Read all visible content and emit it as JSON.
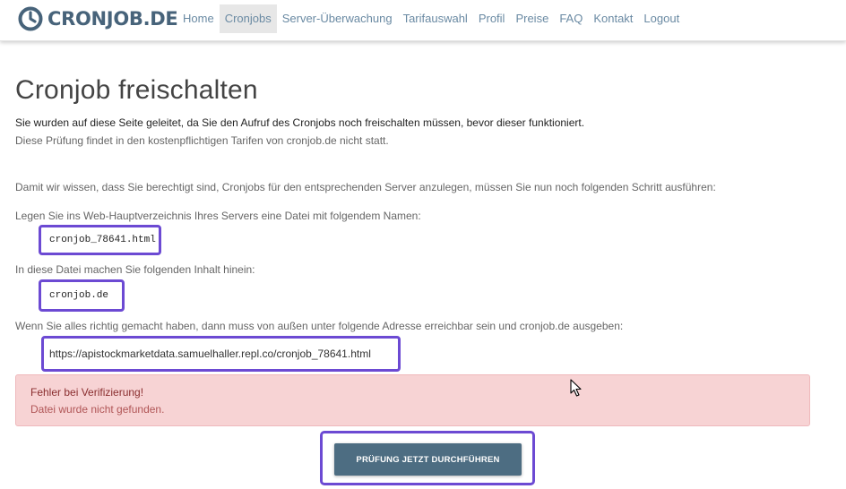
{
  "brand": {
    "name": "CRONJOB.DE",
    "color": "#47637a",
    "icon": "clock-logo-icon"
  },
  "nav": {
    "items": [
      {
        "label": "Home",
        "active": false
      },
      {
        "label": "Cronjobs",
        "active": true
      },
      {
        "label": "Server-Überwachung",
        "active": false
      },
      {
        "label": "Tarifauswahl",
        "active": false
      },
      {
        "label": "Profil",
        "active": false
      },
      {
        "label": "Preise",
        "active": false
      },
      {
        "label": "FAQ",
        "active": false
      },
      {
        "label": "Kontakt",
        "active": false
      },
      {
        "label": "Logout",
        "active": false
      }
    ]
  },
  "page": {
    "title": "Cronjob freischalten",
    "intro_strong": "Sie wurden auf diese Seite geleitet, da Sie den Aufruf des Cronjobs noch freischalten müssen, bevor dieser funktioniert.",
    "intro_note": "Diese Prüfung findet in den kostenpflichtigen Tarifen von cronjob.de nicht statt.",
    "step_intro": "Damit wir wissen, dass Sie berechtigt sind, Cronjobs für den entsprechenden Server anzulegen, müssen Sie nun noch folgenden Schritt ausführen:",
    "file_instruction": "Legen Sie ins Web-Hauptverzeichnis Ihres Servers eine Datei mit folgendem Namen:",
    "file_name": "cronjob_78641.html",
    "content_instruction": "In diese Datei machen Sie folgenden Inhalt hinein:",
    "file_content": "cronjob.de",
    "url_instruction": "Wenn Sie alles richtig gemacht haben, dann muss von außen unter folgende Adresse erreichbar sein und cronjob.de ausgeben:",
    "verify_url": "https://apistockmarketdata.samuelhaller.repl.co/cronjob_78641.html"
  },
  "alert": {
    "title": "Fehler bei Verifizierung!",
    "message": "Datei wurde nicht gefunden.",
    "background": "#f7d3d4"
  },
  "action": {
    "label": "PRÜFUNG JETZT DURCHFÜHREN",
    "color": "#4d6d82"
  },
  "highlight_color": "#6c4ad3"
}
